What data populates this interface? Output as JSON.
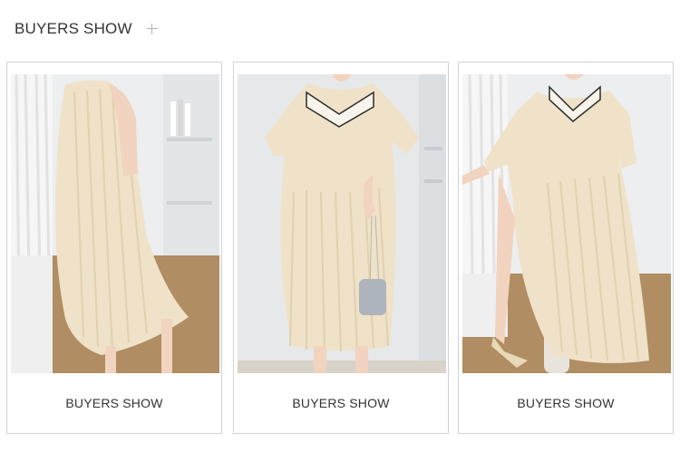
{
  "header": {
    "title": "BUYERS SHOW",
    "plus_icon": "plus-icon"
  },
  "cards": [
    {
      "caption": "BUYERS SHOW"
    },
    {
      "caption": "BUYERS SHOW"
    },
    {
      "caption": "BUYERS SHOW"
    }
  ],
  "colors": {
    "dress": "#efe2c8",
    "dress_shade": "#e2d0ae",
    "wall": "#eceeef",
    "floor": "#b08d62",
    "curtain": "#f4f4f4",
    "skin": "#f1d3bf",
    "collar_trim": "#2b2b2b"
  }
}
